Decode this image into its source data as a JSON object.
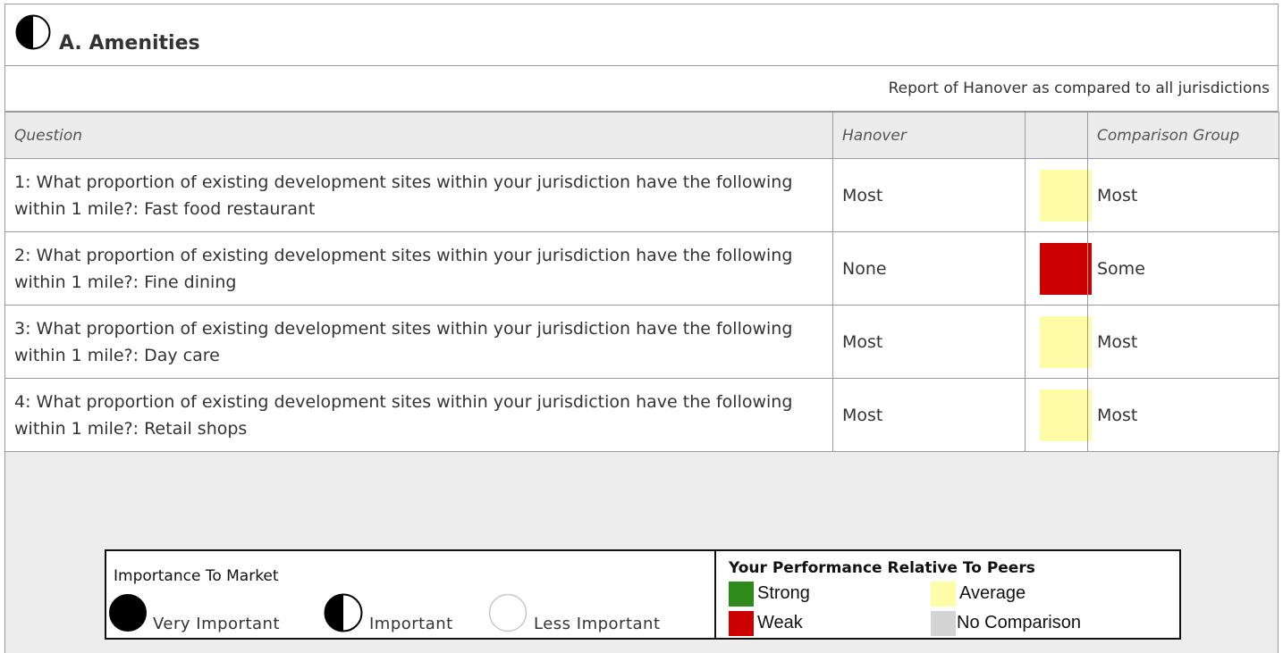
{
  "section": {
    "title": "A. Amenities",
    "report_caption": "Report of Hanover as compared to all jurisdictions"
  },
  "table": {
    "headers": {
      "question": "Question",
      "jurisdiction": "Hanover",
      "indicator": "",
      "comparison": "Comparison Group"
    },
    "rows": [
      {
        "question": "1: What proportion of existing development sites within your jurisdiction have the following within 1 mile?: Fast food restaurant",
        "jurisdiction_value": "Most",
        "rating": "Average",
        "rating_color": "#fffca8",
        "comparison_value": "Most"
      },
      {
        "question": "2: What proportion of existing development sites within your jurisdiction have the following within 1 mile?: Fine dining",
        "jurisdiction_value": "None",
        "rating": "Weak",
        "rating_color": "#cc0000",
        "comparison_value": "Some"
      },
      {
        "question": "3: What proportion of existing development sites within your jurisdiction have the following within 1 mile?: Day care",
        "jurisdiction_value": "Most",
        "rating": "Average",
        "rating_color": "#fffca8",
        "comparison_value": "Most"
      },
      {
        "question": "4: What proportion of existing development sites within your jurisdiction have the following within 1 mile?: Retail shops",
        "jurisdiction_value": "Most",
        "rating": "Average",
        "rating_color": "#fffca8",
        "comparison_value": "Most"
      }
    ]
  },
  "legend": {
    "importance": {
      "title": "Importance To Market",
      "items": [
        {
          "label": "Very Important",
          "icon": "full-circle-icon"
        },
        {
          "label": "Important",
          "icon": "half-circle-icon"
        },
        {
          "label": "Less Important",
          "icon": "empty-circle-icon"
        }
      ]
    },
    "performance": {
      "title": "Your Performance Relative To Peers",
      "items": [
        {
          "label": "Strong",
          "color": "#2e8b1a"
        },
        {
          "label": "Average",
          "color": "#fffca8"
        },
        {
          "label": "Weak",
          "color": "#cc0000"
        },
        {
          "label": "No Comparison",
          "color": "#d3d3d3"
        }
      ]
    }
  }
}
